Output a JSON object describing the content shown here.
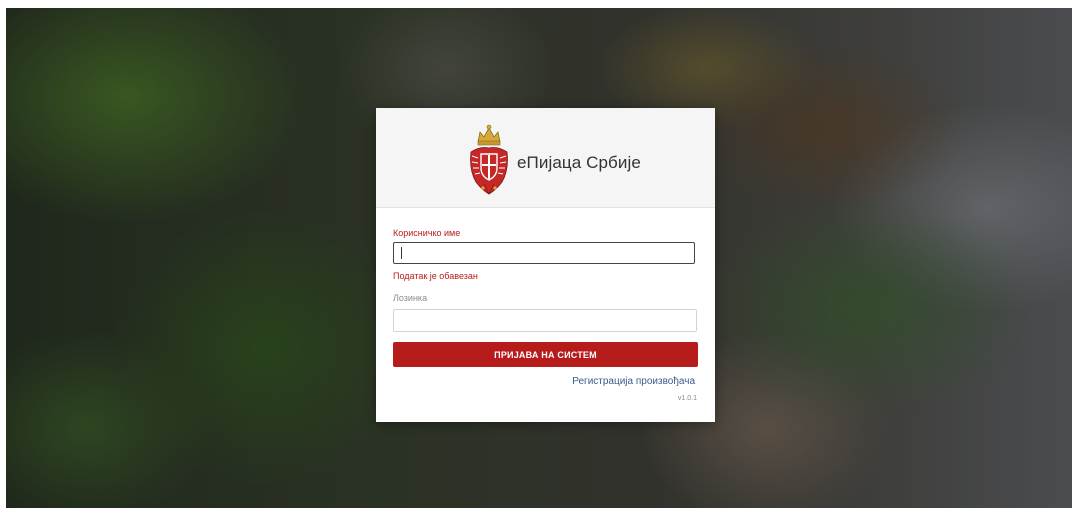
{
  "brand": {
    "title": "еПијаца Србије",
    "emblem_icon": "serbian-coat-of-arms-icon"
  },
  "login_form": {
    "username_label": "Корисничко име",
    "username_value": "",
    "username_error": "Податак је обавезан",
    "password_label": "Лозинка",
    "password_value": "",
    "submit_label": "ПРИЈАВА НА СИСТЕМ",
    "register_link": "Регистрација произвођача",
    "version": "v1.0.1"
  },
  "colors": {
    "accent": "#b71c1c",
    "link": "#3a5a8c",
    "header_bg": "#f5f5f5"
  }
}
